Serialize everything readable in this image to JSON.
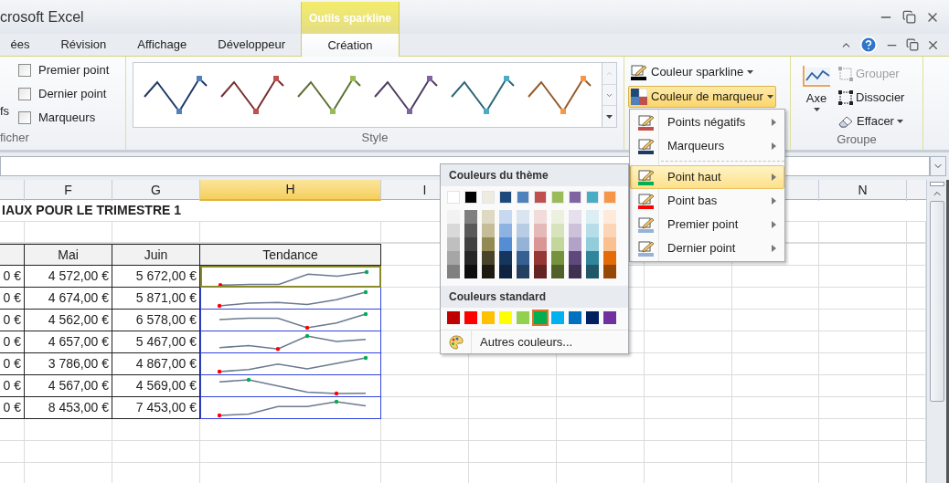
{
  "window": {
    "title": "crosoft Excel"
  },
  "tabs": [
    {
      "label": "ées",
      "selected": false
    },
    {
      "label": "Révision",
      "selected": false
    },
    {
      "label": "Affichage",
      "selected": false
    },
    {
      "label": "Développeur",
      "selected": false
    }
  ],
  "context_tabs": {
    "title": "Outils sparkline",
    "tabs": [
      {
        "label": "Création",
        "selected": true
      }
    ]
  },
  "ribbon": {
    "show_group": {
      "label": "ficher",
      "cut_label": "fs",
      "options": [
        {
          "label": "Premier point",
          "checked": false
        },
        {
          "label": "Dernier point",
          "checked": false
        },
        {
          "label": "Marqueurs",
          "checked": false
        }
      ]
    },
    "style_group": {
      "label": "Style",
      "styles": [
        {
          "color": "#4f81bd"
        },
        {
          "color": "#c0504d"
        },
        {
          "color": "#9bbb59"
        },
        {
          "color": "#8064a2"
        },
        {
          "color": "#4bacc6"
        },
        {
          "color": "#f79646"
        }
      ]
    },
    "color_buttons": [
      {
        "label": "Couleur sparkline",
        "kind": "pencil",
        "open": false
      },
      {
        "label": "Couleur de marqueur",
        "kind": "marker",
        "open": true
      }
    ],
    "group_group": {
      "label": "Groupe",
      "axis": {
        "label": "Axe"
      },
      "buttons": [
        {
          "label": "Grouper",
          "kind": "group",
          "disabled": true,
          "dropdown": false
        },
        {
          "label": "Dissocier",
          "kind": "ungroup",
          "disabled": false,
          "dropdown": false
        },
        {
          "label": "Effacer",
          "kind": "eraser",
          "disabled": false,
          "dropdown": true
        }
      ]
    }
  },
  "sheet": {
    "columns": [
      {
        "label": "F",
        "selected": false
      },
      {
        "label": "G",
        "selected": false
      },
      {
        "label": "H",
        "selected": true
      },
      {
        "label": "I",
        "selected": false
      }
    ],
    "far_columns": [
      {
        "label": "N",
        "selected": false
      }
    ],
    "title": "IAUX POUR LE TRIMESTRE 1",
    "headers": [
      "Mai",
      "Juin",
      "Tendance"
    ],
    "rows": [
      {
        "cut": "0 €",
        "may": "4 572,00 €",
        "june": "5 672,00 €",
        "selected": true
      },
      {
        "cut": "0 €",
        "may": "4 674,00 €",
        "june": "5 871,00 €",
        "selected": false
      },
      {
        "cut": "0 €",
        "may": "4 562,00 €",
        "june": "6 578,00 €",
        "selected": false
      },
      {
        "cut": "0 €",
        "may": "4 657,00 €",
        "june": "5 467,00 €",
        "selected": false
      },
      {
        "cut": "0 €",
        "may": "3 786,00 €",
        "june": "4 867,00 €",
        "selected": false
      },
      {
        "cut": "0 €",
        "may": "4 567,00 €",
        "june": "4 569,00 €",
        "selected": false
      },
      {
        "cut": "0 €",
        "may": "8 453,00 €",
        "june": "7 453,00 €",
        "selected": false
      }
    ]
  },
  "marker_menu": {
    "sections": [
      [
        {
          "label": "Points négatifs",
          "color": "#c0504d",
          "selected": false
        },
        {
          "label": "Marqueurs",
          "color": "#1f3864",
          "selected": false
        }
      ],
      [
        {
          "label": "Point haut",
          "color": "#00b050",
          "selected": true
        },
        {
          "label": "Point bas",
          "color": "#ff0000",
          "selected": false
        },
        {
          "label": "Premier point",
          "color": "#95b3d7",
          "selected": false
        },
        {
          "label": "Dernier point",
          "color": "#95b3d7",
          "selected": false
        }
      ]
    ]
  },
  "color_picker": {
    "theme_title": "Couleurs du thème",
    "theme_colors": [
      {
        "color": "#ffffff",
        "shades": [
          {
            "color": "#f2f2f2"
          },
          {
            "color": "#d9d9d9"
          },
          {
            "color": "#bfbfbf"
          },
          {
            "color": "#a6a6a6"
          },
          {
            "color": "#808080"
          }
        ]
      },
      {
        "color": "#000000",
        "shades": [
          {
            "color": "#7f7f7f"
          },
          {
            "color": "#595959"
          },
          {
            "color": "#404040"
          },
          {
            "color": "#262626"
          },
          {
            "color": "#0d0d0d"
          }
        ]
      },
      {
        "color": "#eeece1",
        "shades": [
          {
            "color": "#ddd9c3"
          },
          {
            "color": "#c4bd97"
          },
          {
            "color": "#938953"
          },
          {
            "color": "#494429"
          },
          {
            "color": "#1d1b10"
          }
        ]
      },
      {
        "color": "#1f497d",
        "shades": [
          {
            "color": "#c6d9f0"
          },
          {
            "color": "#8db3e2"
          },
          {
            "color": "#548dd4"
          },
          {
            "color": "#17365d"
          },
          {
            "color": "#0f243e"
          }
        ]
      },
      {
        "color": "#4f81bd",
        "shades": [
          {
            "color": "#dbe5f1"
          },
          {
            "color": "#b8cce4"
          },
          {
            "color": "#95b3d7"
          },
          {
            "color": "#366092"
          },
          {
            "color": "#244061"
          }
        ]
      },
      {
        "color": "#c0504d",
        "shades": [
          {
            "color": "#f2dcdb"
          },
          {
            "color": "#e5b9b7"
          },
          {
            "color": "#d99694"
          },
          {
            "color": "#953734"
          },
          {
            "color": "#632423"
          }
        ]
      },
      {
        "color": "#9bbb59",
        "shades": [
          {
            "color": "#ebf1dd"
          },
          {
            "color": "#d7e3bc"
          },
          {
            "color": "#c3d69b"
          },
          {
            "color": "#76923c"
          },
          {
            "color": "#4f6128"
          }
        ]
      },
      {
        "color": "#8064a2",
        "shades": [
          {
            "color": "#e5e0ec"
          },
          {
            "color": "#ccc1d9"
          },
          {
            "color": "#b2a2c7"
          },
          {
            "color": "#5f497a"
          },
          {
            "color": "#3f3151"
          }
        ]
      },
      {
        "color": "#4bacc6",
        "shades": [
          {
            "color": "#dbeef3"
          },
          {
            "color": "#b7dde8"
          },
          {
            "color": "#92cddc"
          },
          {
            "color": "#31859b"
          },
          {
            "color": "#205867"
          }
        ]
      },
      {
        "color": "#f79646",
        "shades": [
          {
            "color": "#fdeada"
          },
          {
            "color": "#fbd5b5"
          },
          {
            "color": "#fac08f"
          },
          {
            "color": "#e36c09"
          },
          {
            "color": "#974806"
          }
        ]
      }
    ],
    "standard_title": "Couleurs standard",
    "standard_colors": [
      {
        "color": "#c00000",
        "selected": false
      },
      {
        "color": "#ff0000",
        "selected": false
      },
      {
        "color": "#ffc000",
        "selected": false
      },
      {
        "color": "#ffff00",
        "selected": false
      },
      {
        "color": "#92d050",
        "selected": false
      },
      {
        "color": "#00b050",
        "selected": true
      },
      {
        "color": "#00b0f0",
        "selected": false
      },
      {
        "color": "#0070c0",
        "selected": false
      },
      {
        "color": "#002060",
        "selected": false
      },
      {
        "color": "#7030a0",
        "selected": false
      }
    ],
    "more": "Autres couleurs..."
  }
}
